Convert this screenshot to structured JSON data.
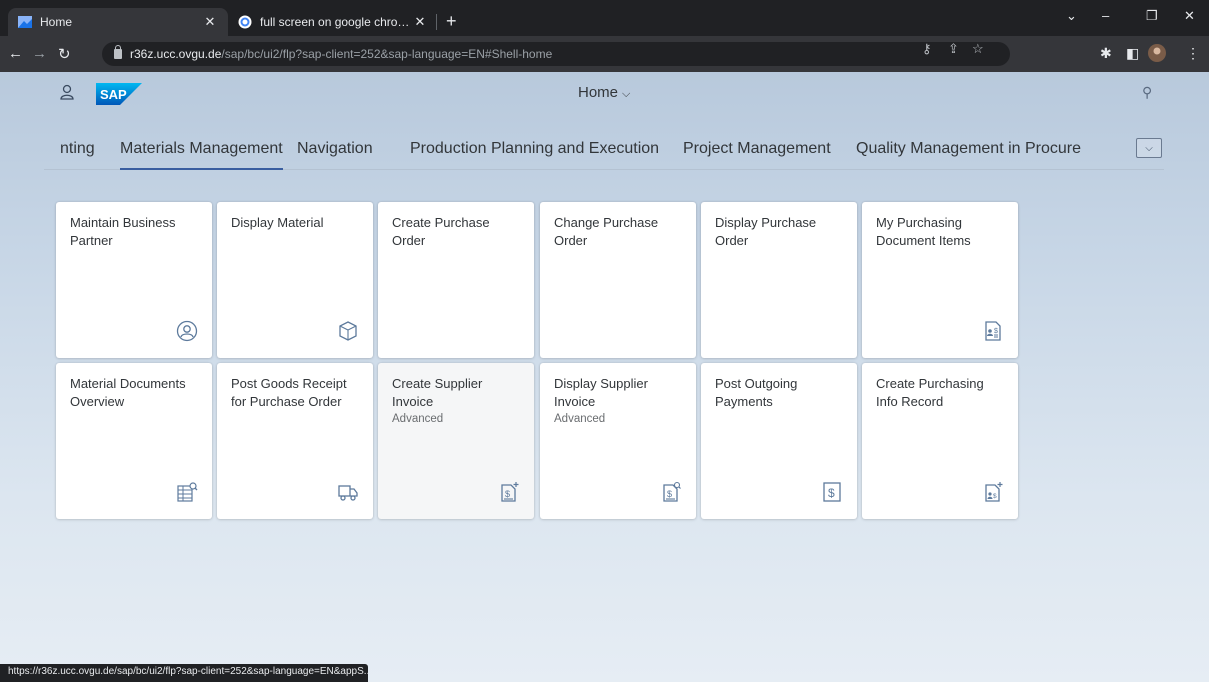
{
  "browser": {
    "tabs": [
      {
        "title": "Home",
        "active": true
      },
      {
        "title": "full screen on google chrome - G",
        "active": false
      }
    ],
    "new_tab_label": "+",
    "url_host": "r36z.ucc.ovgu.de",
    "url_path": "/sap/bc/ui2/flp?sap-client=252&sap-language=EN#Shell-home",
    "status_url": "https://r36z.ucc.ovgu.de/sap/bc/ui2/flp?sap-client=252&sap-language=EN&appS..."
  },
  "shell": {
    "logo_text": "SAP",
    "title": "Home"
  },
  "anchor_bar": {
    "items": [
      "nting",
      "Materials Management",
      "Navigation",
      "Production Planning and Execution",
      "Project Management",
      "Quality Management in Procure"
    ],
    "selected": "Materials Management"
  },
  "tiles": [
    {
      "title": "Maintain Business Partner",
      "subtitle": "",
      "icon": "person-icon"
    },
    {
      "title": "Display Material",
      "subtitle": "",
      "icon": "cube-icon"
    },
    {
      "title": "Create Purchase Order",
      "subtitle": "",
      "icon": ""
    },
    {
      "title": "Change Purchase Order",
      "subtitle": "",
      "icon": ""
    },
    {
      "title": "Display Purchase Order",
      "subtitle": "",
      "icon": ""
    },
    {
      "title": "My Purchasing Document Items",
      "subtitle": "",
      "icon": "document-dollar-icon"
    },
    {
      "title": "Material Documents Overview",
      "subtitle": "",
      "icon": "table-search-icon"
    },
    {
      "title": "Post Goods Receipt for Purchase Order",
      "subtitle": "",
      "icon": "truck-icon"
    },
    {
      "title": "Create Supplier Invoice",
      "subtitle": "Advanced",
      "icon": "invoice-add-icon"
    },
    {
      "title": "Display Supplier Invoice",
      "subtitle": "Advanced",
      "icon": "invoice-search-icon"
    },
    {
      "title": "Post Outgoing Payments",
      "subtitle": "",
      "icon": "dollar-icon"
    },
    {
      "title": "Create Purchasing Info Record",
      "subtitle": "",
      "icon": "document-add-icon"
    }
  ]
}
